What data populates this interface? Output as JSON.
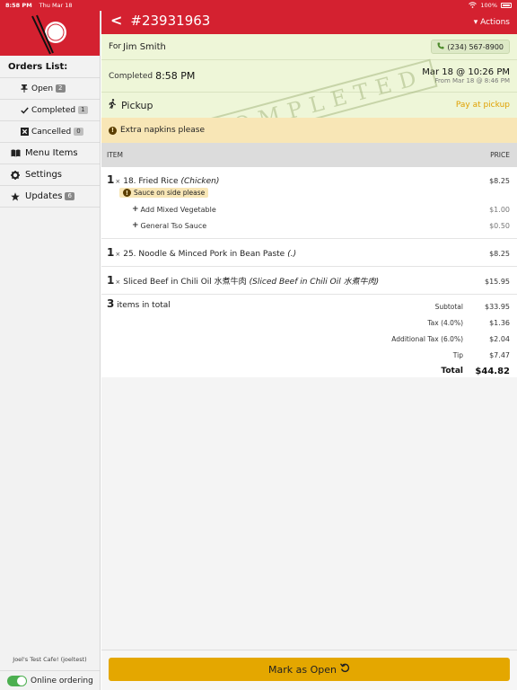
{
  "status_bar": {
    "time": "8:58 PM",
    "date": "Thu Mar 18",
    "battery": "100%"
  },
  "sidebar": {
    "heading": "Orders List:",
    "orders": [
      {
        "label": "Open",
        "count": "2",
        "icon": "pin-icon"
      },
      {
        "label": "Completed",
        "count": "1",
        "icon": "check-icon"
      },
      {
        "label": "Cancelled",
        "count": "0",
        "icon": "cancel-box-icon"
      }
    ],
    "menu_items_label": "Menu Items",
    "settings_label": "Settings",
    "updates_label": "Updates",
    "updates_count": "6",
    "cafe_name": "Joel's Test Cafe! (joeltest)",
    "online_label": "Online ordering"
  },
  "header": {
    "back": "<",
    "order_number": "#23931963",
    "actions_label": "▾ Actions"
  },
  "order": {
    "for_label": "For",
    "customer_name": "Jim Smith",
    "phone": "(234) 567-8900",
    "completed_label": "Completed",
    "completed_time": "8:58 PM",
    "date_main": "Mar 18 @ 10:26 PM",
    "date_from": "From Mar 18 @ 8:46 PM",
    "pickup_label": "Pickup",
    "pay_label": "Pay at pickup",
    "stamp": "COMPLETED",
    "note": "Extra napkins please"
  },
  "table": {
    "item_header": "ITEM",
    "price_header": "PRICE"
  },
  "items": [
    {
      "qty": "1",
      "name": "18. Fried Rice",
      "modifier": "(Chicken)",
      "price": "$8.25",
      "note": "Sauce on side please",
      "addons": [
        {
          "name": "Add Mixed Vegetable",
          "price": "$1.00"
        },
        {
          "name": "General Tso Sauce",
          "price": "$0.50"
        }
      ]
    },
    {
      "qty": "1",
      "name": "25. Noodle & Minced Pork in Bean Paste",
      "modifier": "(.)",
      "price": "$8.25"
    },
    {
      "qty": "1",
      "name": "Sliced Beef in Chili Oil 水煮牛肉",
      "modifier": "(Sliced Beef in Chili Oil 水煮牛肉)",
      "price": "$15.95"
    }
  ],
  "totals": {
    "count": "3",
    "count_label": "items in total",
    "rows": [
      {
        "label": "Subtotal",
        "value": "$33.95"
      },
      {
        "label": "Tax (4.0%)",
        "value": "$1.36"
      },
      {
        "label": "Additional Tax (6.0%)",
        "value": "$2.04"
      },
      {
        "label": "Tip",
        "value": "$7.47"
      },
      {
        "label": "Total",
        "value": "$44.82"
      }
    ]
  },
  "bottom_button": "Mark as Open",
  "colors": {
    "brand_red": "#d42130",
    "accent_gold": "#e4a700",
    "completed_green": "#eef6d8",
    "note_yellow": "#f8e6b6"
  }
}
